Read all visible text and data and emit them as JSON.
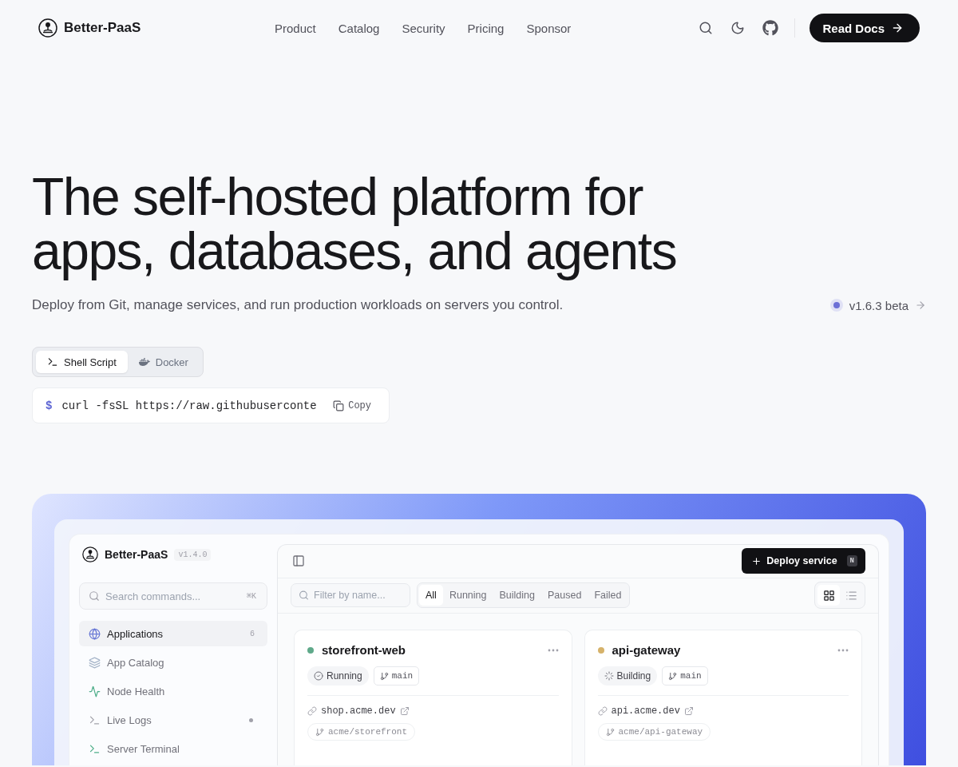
{
  "header": {
    "brand": "Better-PaaS",
    "nav": [
      {
        "label": "Product"
      },
      {
        "label": "Catalog"
      },
      {
        "label": "Security"
      },
      {
        "label": "Pricing"
      },
      {
        "label": "Sponsor"
      }
    ],
    "cta": "Read Docs"
  },
  "hero": {
    "title_lines": [
      "The self-hosted platform for",
      "apps, databases, and agents"
    ],
    "subtitle": "Deploy from Git, manage services, and run production workloads on servers you control.",
    "version_badge": "v1.6.3 beta"
  },
  "install": {
    "tabs": [
      {
        "label": "Shell Script",
        "kind": "shell",
        "selected": true
      },
      {
        "label": "Docker",
        "kind": "docker",
        "selected": false
      }
    ],
    "prompt": "$",
    "command": "curl -fsSL https://raw.githubuserconte",
    "copy_label": "Copy"
  },
  "preview": {
    "sidebar": {
      "brand": "Better-PaaS",
      "version": "v1.4.0",
      "search_placeholder": "Search commands...",
      "shortcut": "⌘K",
      "items": [
        {
          "label": "Applications",
          "kind": "globe",
          "selected": true,
          "count": "6",
          "indicator": false
        },
        {
          "label": "App Catalog",
          "kind": "layers",
          "selected": false,
          "indicator": false
        },
        {
          "label": "Node Health",
          "kind": "pulse",
          "selected": false,
          "indicator": false
        },
        {
          "label": "Live Logs",
          "kind": "terminal",
          "selected": false,
          "indicator": true
        },
        {
          "label": "Server Terminal",
          "kind": "terminal-accent",
          "selected": false,
          "indicator": false
        }
      ]
    },
    "toolbar": {
      "deploy_label": "Deploy service",
      "deploy_key": "N",
      "filter_placeholder": "Filter by name...",
      "filters": [
        {
          "label": "All",
          "selected": true
        },
        {
          "label": "Running",
          "selected": false
        },
        {
          "label": "Building",
          "selected": false
        },
        {
          "label": "Paused",
          "selected": false
        },
        {
          "label": "Failed",
          "selected": false
        }
      ],
      "views": [
        {
          "kind": "grid",
          "selected": true
        },
        {
          "kind": "list",
          "selected": false
        }
      ]
    },
    "services": [
      {
        "name": "storefront-web",
        "color": "#5fa98a",
        "status": "Running",
        "kind": "running",
        "branch": "main",
        "url": "shop.acme.dev",
        "repo": "acme/storefront"
      },
      {
        "name": "api-gateway",
        "color": "#d6b26a",
        "status": "Building",
        "kind": "building",
        "branch": "main",
        "url": "api.acme.dev",
        "repo": "acme/api-gateway"
      }
    ]
  }
}
